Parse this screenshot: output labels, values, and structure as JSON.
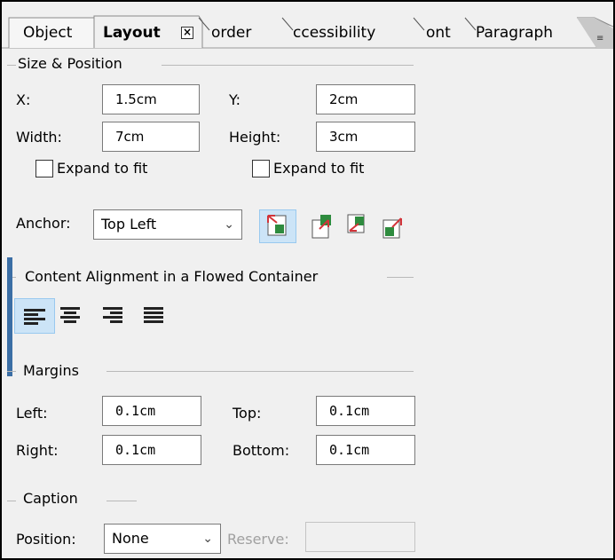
{
  "tabs": [
    {
      "label": "Object"
    },
    {
      "label": "Layout"
    },
    {
      "label": "Border"
    },
    {
      "label": "Accessibility"
    },
    {
      "label": "Font"
    },
    {
      "label": "Paragraph"
    }
  ],
  "tab_visible": {
    "object": "Object",
    "layout": "Layout",
    "border": "order",
    "accessibility": "ccessibility",
    "font": "ont",
    "paragraph": "Paragraph"
  },
  "size_position": {
    "group_label": "Size & Position",
    "x_label": "X:",
    "x_value": "1.5cm",
    "y_label": "Y:",
    "y_value": "2cm",
    "width_label": "Width:",
    "width_value": "7cm",
    "height_label": "Height:",
    "height_value": "3cm",
    "expand_width_label": "Expand to fit",
    "expand_height_label": "Expand to fit"
  },
  "anchor": {
    "label": "Anchor:",
    "value": "Top Left",
    "icons": [
      "anchor-top-left-icon",
      "anchor-top-right-icon",
      "anchor-bottom-left-icon",
      "anchor-bottom-right-icon"
    ]
  },
  "content_alignment": {
    "group_label": "Content Alignment in a Flowed Container",
    "buttons": [
      "align-left-icon",
      "align-center-icon",
      "align-right-icon",
      "align-justify-icon"
    ]
  },
  "margins": {
    "group_label": "Margins",
    "left_label": "Left:",
    "left_value": "0.1cm",
    "top_label": "Top:",
    "top_value": "0.1cm",
    "right_label": "Right:",
    "right_value": "0.1cm",
    "bottom_label": "Bottom:",
    "bottom_value": "0.1cm"
  },
  "caption": {
    "group_label": "Caption",
    "position_label": "Position:",
    "position_value": "None",
    "reserve_label": "Reserve:",
    "reserve_value": ""
  },
  "colors": {
    "panel": "#f0f0f0",
    "selected_btn": "#cce4f7",
    "selected_border": "#99c9ef",
    "icon_red": "#d2343a",
    "icon_green": "#2e8b3e",
    "icon_blue": "#2f6fb5"
  }
}
